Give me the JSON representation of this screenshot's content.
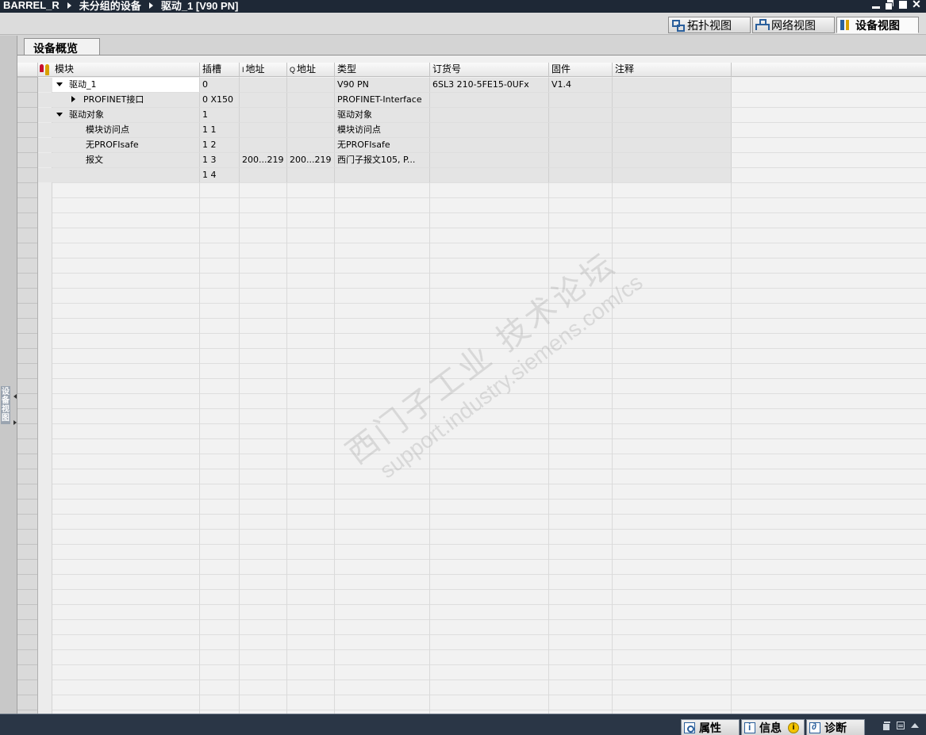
{
  "titlebar": {
    "crumbs": [
      "BARREL_R",
      "未分组的设备",
      "驱动_1 [V90 PN]"
    ]
  },
  "view_tabs": [
    {
      "label": "拓扑视图",
      "icon": "topology-view-icon"
    },
    {
      "label": "网络视图",
      "icon": "network-view-icon"
    },
    {
      "label": "设备视图",
      "icon": "device-view-icon",
      "active": true
    }
  ],
  "side_panel": {
    "label": "设备视图"
  },
  "overview_tab": {
    "label": "设备概览"
  },
  "table": {
    "headers": {
      "module": "模块",
      "slot": "插槽",
      "i_prefix": "I",
      "i_address": "地址",
      "q_prefix": "Q",
      "q_address": "地址",
      "type": "类型",
      "order_no": "订货号",
      "firmware": "固件",
      "comment": "注释"
    },
    "rows": [
      {
        "module": "驱动_1",
        "slot": "0",
        "i_address": "",
        "q_address": "",
        "type": "V90 PN",
        "order_no": "6SL3 210-5FE15-0UFx",
        "firmware": "V1.4",
        "comment": ""
      },
      {
        "module": "PROFINET接口",
        "slot": "0 X150",
        "i_address": "",
        "q_address": "",
        "type": "PROFINET-Interface",
        "order_no": "",
        "firmware": "",
        "comment": ""
      },
      {
        "module": "驱动对象",
        "slot": "1",
        "i_address": "",
        "q_address": "",
        "type": "驱动对象",
        "order_no": "",
        "firmware": "",
        "comment": ""
      },
      {
        "module": "模块访问点",
        "slot": "1 1",
        "i_address": "",
        "q_address": "",
        "type": "模块访问点",
        "order_no": "",
        "firmware": "",
        "comment": ""
      },
      {
        "module": "无PROFIsafe",
        "slot": "1 2",
        "i_address": "",
        "q_address": "",
        "type": "无PROFIsafe",
        "order_no": "",
        "firmware": "",
        "comment": ""
      },
      {
        "module": "报文",
        "slot": "1 3",
        "i_address": "200...219",
        "q_address": "200...219",
        "type": "西门子报文105, P...",
        "order_no": "",
        "firmware": "",
        "comment": ""
      },
      {
        "module": "",
        "slot": "1 4",
        "i_address": "",
        "q_address": "",
        "type": "",
        "order_no": "",
        "firmware": "",
        "comment": ""
      }
    ]
  },
  "watermark": {
    "line1": "西门子工业  技术论坛",
    "line2": "support.industry.siemens.com/cs"
  },
  "bottom_tabs": [
    {
      "label": "属性",
      "icon": "properties-icon"
    },
    {
      "label": "信息",
      "icon": "info-icon",
      "badge": "i"
    },
    {
      "label": "诊断",
      "icon": "diagnostics-icon"
    }
  ],
  "colors": {
    "titlebar_bg": "#1e2836",
    "bottombar_bg": "#2a3646",
    "accent_blue": "#2a5f9c"
  }
}
